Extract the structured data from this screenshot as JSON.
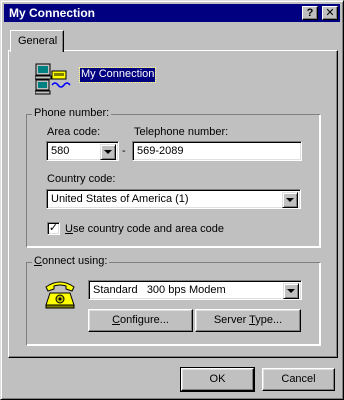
{
  "window": {
    "title": "My Connection",
    "help_button": "?",
    "close_button": "✕"
  },
  "tabs": [
    {
      "label": "General"
    }
  ],
  "connection": {
    "name": "My Connection",
    "icon": "computers-modem-icon"
  },
  "phone_number": {
    "group_label": "Phone number:",
    "area_code_label": "Area code:",
    "area_code_value": "580",
    "separator": "-",
    "telephone_label": "Telephone number:",
    "telephone_value": "569-2089",
    "country_code_label": "Country code:",
    "country_code_value": "United States of America (1)",
    "use_country_area": {
      "label_underlined": "U",
      "label_rest": "se country code and area code",
      "checked": true
    }
  },
  "connect_using": {
    "group_label_underlined": "C",
    "group_label_rest": "onnect using:",
    "icon": "telephone-icon",
    "device_value": "Standard   300 bps Modem",
    "configure": {
      "underlined": "C",
      "rest": "onfigure..."
    },
    "server_type": {
      "before": "Server ",
      "underlined": "T",
      "after": "ype..."
    }
  },
  "footer": {
    "ok_label": "OK",
    "cancel_label": "Cancel"
  }
}
